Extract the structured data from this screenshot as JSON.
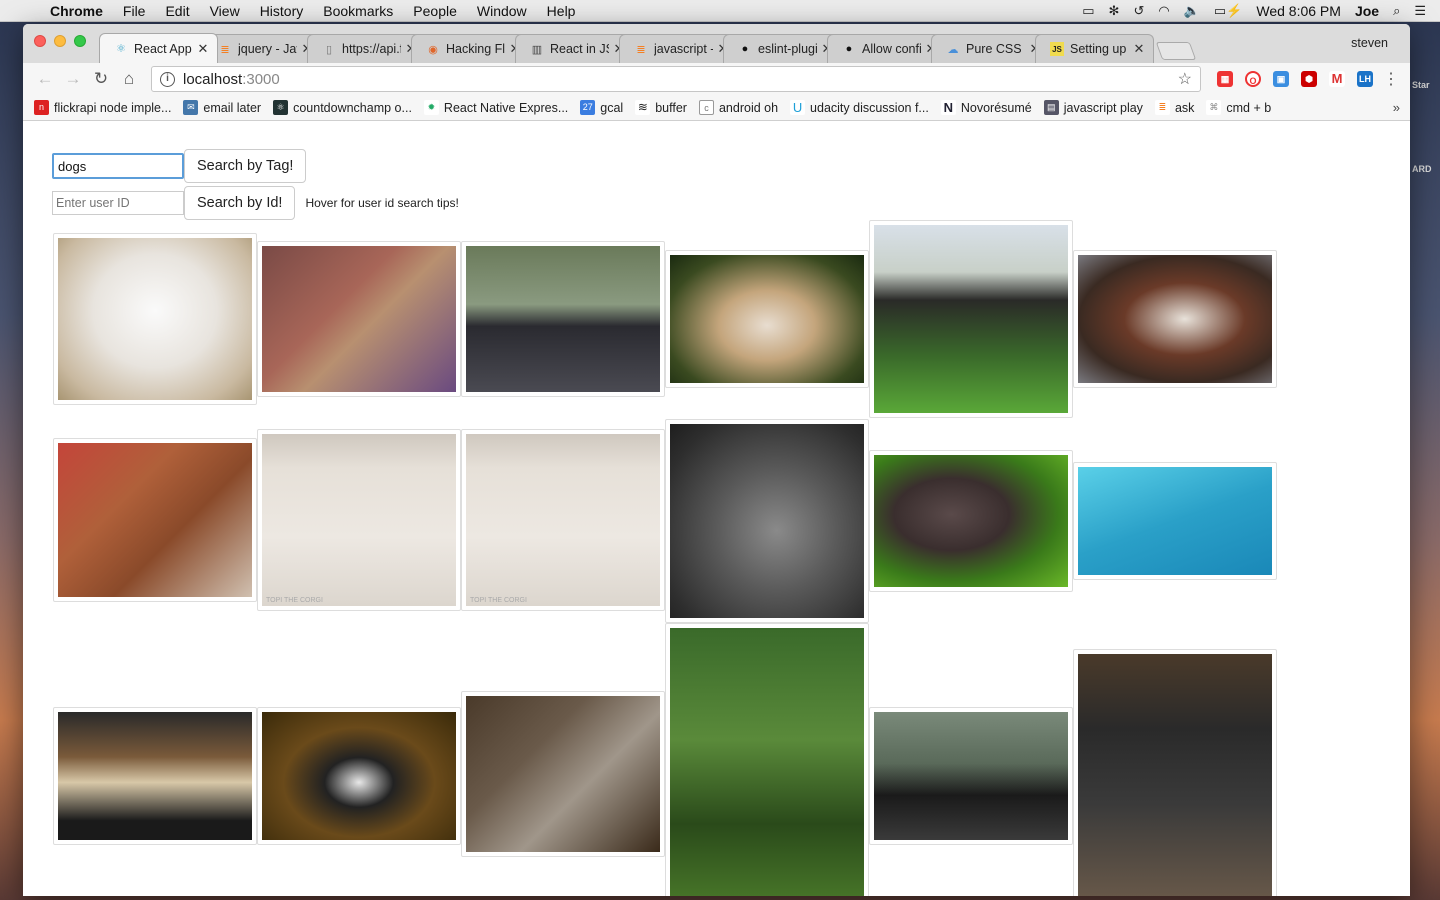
{
  "menubar": {
    "app": "Chrome",
    "items": [
      "File",
      "Edit",
      "View",
      "History",
      "Bookmarks",
      "People",
      "Window",
      "Help"
    ],
    "clock": "Wed 8:06 PM",
    "user": "Joe"
  },
  "desktop": {
    "side_label_1": "Star",
    "side_label_2": "ARD"
  },
  "browser": {
    "profile": "steven",
    "tabs": [
      {
        "title": "React App",
        "icon": "react-icon"
      },
      {
        "title": "jquery - Jav",
        "icon": "stackoverflow-icon"
      },
      {
        "title": "https://api.f",
        "icon": "page-icon"
      },
      {
        "title": "Hacking Flic",
        "icon": "hacking-icon"
      },
      {
        "title": "React in JS>",
        "icon": "book-icon"
      },
      {
        "title": "javascript -",
        "icon": "stackoverflow-icon"
      },
      {
        "title": "eslint-plugi",
        "icon": "github-icon"
      },
      {
        "title": "Allow config",
        "icon": "github-icon"
      },
      {
        "title": "Pure CSS h",
        "icon": "cloud-icon"
      },
      {
        "title": "Setting up C",
        "icon": "js-icon"
      }
    ],
    "address": {
      "host": "localhost",
      "port": ":3000"
    },
    "bookmarks": [
      "flickrapi node imple...",
      "email later",
      "countdownchamp o...",
      "React Native Expres...",
      "gcal",
      "buffer",
      "android oh",
      "udacity discussion f...",
      "Novorésumé",
      "javascript play",
      "ask",
      "cmd + b"
    ],
    "gcal_badge": "27"
  },
  "app": {
    "tag_value": "dogs",
    "tag_button": "Search by Tag!",
    "id_placeholder": "Enter user ID",
    "id_button": "Search by Id!",
    "hover_tip": "Hover for user id search tips!",
    "watermark": "TOPI THE CORGI"
  }
}
